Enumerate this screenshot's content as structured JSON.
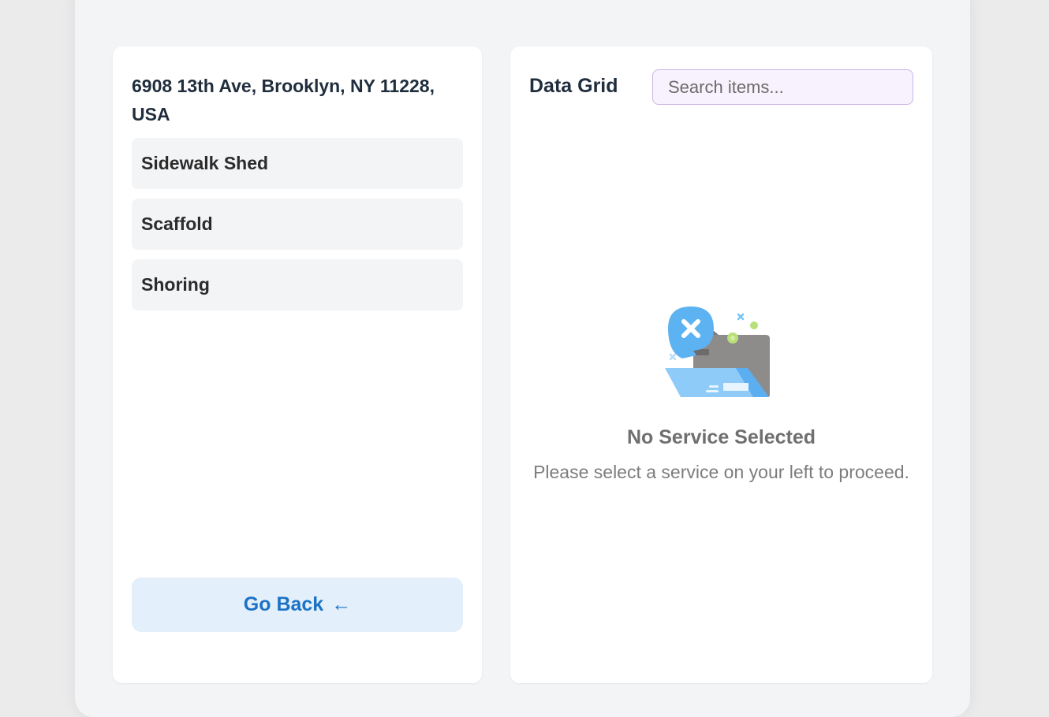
{
  "left_panel": {
    "address": "6908 13th Ave, Brooklyn, NY 11228, USA",
    "services": [
      {
        "label": "Sidewalk Shed"
      },
      {
        "label": "Scaffold"
      },
      {
        "label": "Shoring"
      }
    ],
    "go_back_label": "Go Back",
    "go_back_icon": "←"
  },
  "right_panel": {
    "title": "Data Grid",
    "search": {
      "placeholder": "Search items...",
      "value": ""
    },
    "empty_state": {
      "icon": "empty-folder-x-icon",
      "title": "No Service Selected",
      "message": "Please select a service on your left to proceed."
    }
  },
  "colors": {
    "accent": "#1c72c4",
    "accent_bg": "#e3f0fb",
    "item_bg": "#f3f4f6",
    "search_border": "#c9b6e6"
  }
}
